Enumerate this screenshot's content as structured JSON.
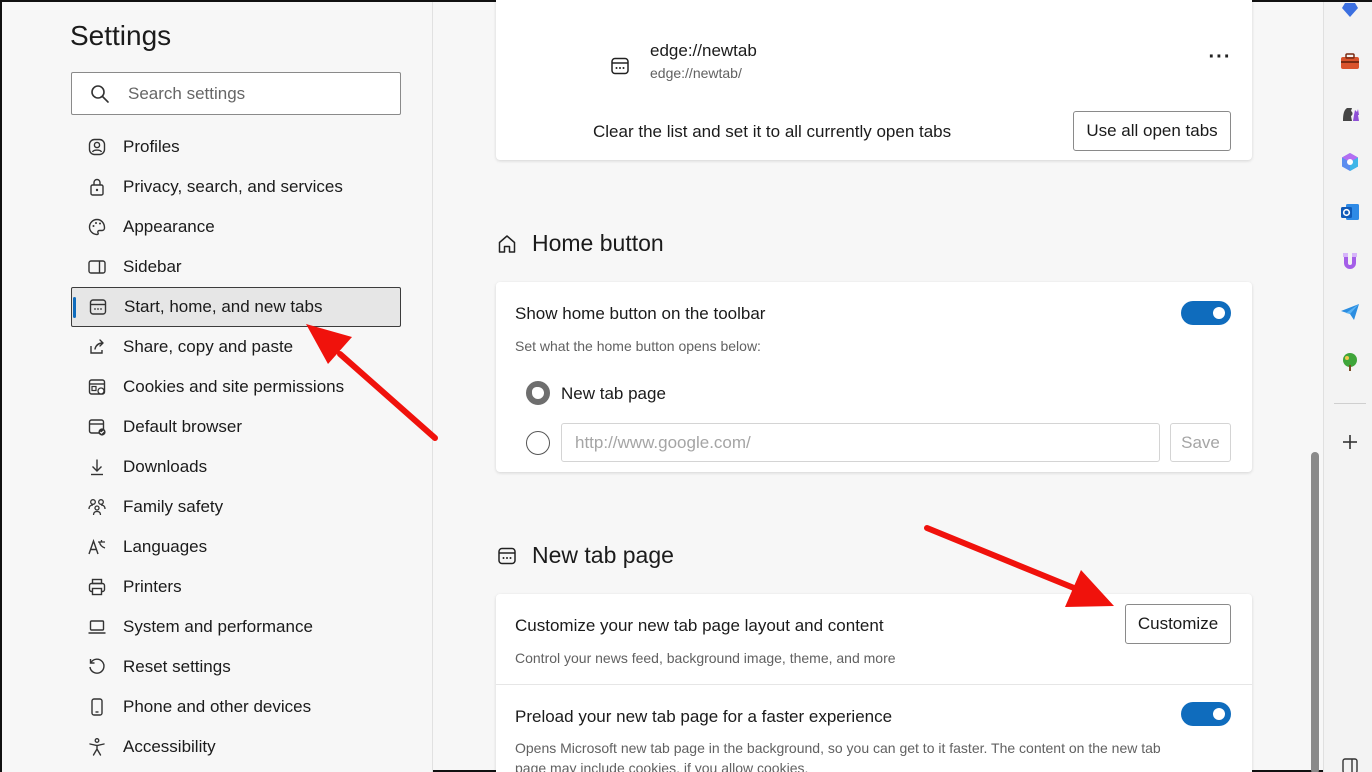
{
  "sidebar": {
    "title": "Settings",
    "search_placeholder": "Search settings",
    "items": [
      {
        "label": "Profiles"
      },
      {
        "label": "Privacy, search, and services"
      },
      {
        "label": "Appearance"
      },
      {
        "label": "Sidebar"
      },
      {
        "label": "Start, home, and new tabs"
      },
      {
        "label": "Share, copy and paste"
      },
      {
        "label": "Cookies and site permissions"
      },
      {
        "label": "Default browser"
      },
      {
        "label": "Downloads"
      },
      {
        "label": "Family safety"
      },
      {
        "label": "Languages"
      },
      {
        "label": "Printers"
      },
      {
        "label": "System and performance"
      },
      {
        "label": "Reset settings"
      },
      {
        "label": "Phone and other devices"
      },
      {
        "label": "Accessibility"
      }
    ],
    "active_item": "Start, home, and new tabs"
  },
  "startup_pages": {
    "entry_title": "edge://newtab",
    "entry_url": "edge://newtab/",
    "more_label": "···",
    "clear_label": "Clear the list and set it to all currently open tabs",
    "use_all_button": "Use all open tabs"
  },
  "home_button": {
    "heading": "Home button",
    "toggle_title": "Show home button on the toolbar",
    "toggle_on": true,
    "subtitle": "Set what the home button opens below:",
    "option_newtab": "New tab page",
    "url_placeholder": "http://www.google.com/",
    "save_button": "Save"
  },
  "new_tab_page": {
    "heading": "New tab page",
    "customize_title": "Customize your new tab page layout and content",
    "customize_sub": "Control your news feed, background image, theme, and more",
    "customize_button": "Customize",
    "preload_title": "Preload your new tab page for a faster experience",
    "preload_on": true,
    "preload_sub_line1": "Opens Microsoft new tab page in the background, so you can get to it faster. The content on the new tab",
    "preload_sub_line2": "page may include cookies, if you allow cookies."
  },
  "colors": {
    "accent": "#0f6cbd",
    "annotation": "#f0120c"
  },
  "right_rail_icons": [
    "tag-icon",
    "toolbox-icon",
    "chess-icon",
    "copilot-icon",
    "outlook-icon",
    "magnet-icon",
    "send-icon",
    "tree-icon",
    "add-icon"
  ]
}
